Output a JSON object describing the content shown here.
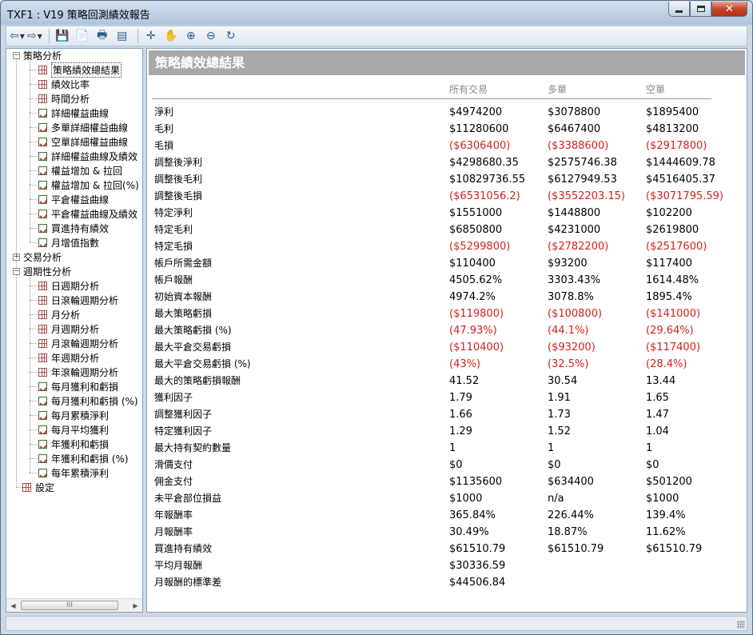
{
  "window": {
    "title": "TXF1 : V19 策略回測績效報告"
  },
  "tree": {
    "groups": [
      {
        "label": "策略分析",
        "expanded": true,
        "items": [
          {
            "label": "策略績效總結果",
            "icon": "grid",
            "selected": true
          },
          {
            "label": "績效比率",
            "icon": "grid"
          },
          {
            "label": "時間分析",
            "icon": "grid"
          },
          {
            "label": "詳細權益曲線",
            "icon": "chart"
          },
          {
            "label": "多單詳細權益曲線",
            "icon": "chart"
          },
          {
            "label": "空單詳細權益曲線",
            "icon": "chart"
          },
          {
            "label": "詳細權益曲線及績效",
            "icon": "chart"
          },
          {
            "label": "權益增加 & 拉回",
            "icon": "chart"
          },
          {
            "label": "權益增加 & 拉回(%)",
            "icon": "chart"
          },
          {
            "label": "平倉權益曲線",
            "icon": "chart"
          },
          {
            "label": "平倉權益曲線及績效",
            "icon": "chart"
          },
          {
            "label": "買進持有績效",
            "icon": "chart"
          },
          {
            "label": "月增值指數",
            "icon": "chart"
          }
        ]
      },
      {
        "label": "交易分析",
        "expanded": false,
        "items": []
      },
      {
        "label": "週期性分析",
        "expanded": true,
        "items": [
          {
            "label": "日週期分析",
            "icon": "grid"
          },
          {
            "label": "日滾輪週期分析",
            "icon": "grid"
          },
          {
            "label": "月分析",
            "icon": "grid"
          },
          {
            "label": "月週期分析",
            "icon": "grid"
          },
          {
            "label": "月滾輪週期分析",
            "icon": "grid"
          },
          {
            "label": "年週期分析",
            "icon": "grid"
          },
          {
            "label": "年滾輪週期分析",
            "icon": "grid"
          },
          {
            "label": "每月獲利和虧損",
            "icon": "chart"
          },
          {
            "label": "每月獲利和虧損 (%)",
            "icon": "chart"
          },
          {
            "label": "每月累積淨利",
            "icon": "chart"
          },
          {
            "label": "每月平均獲利",
            "icon": "chart"
          },
          {
            "label": "年獲利和虧損",
            "icon": "chart"
          },
          {
            "label": "年獲利和虧損 (%)",
            "icon": "chart"
          },
          {
            "label": "每年累積淨利",
            "icon": "chart"
          }
        ]
      },
      {
        "label": "設定",
        "icon": "grid",
        "leaf": true
      }
    ]
  },
  "report": {
    "title": "策略績效總結果",
    "columns": [
      "所有交易",
      "多單",
      "空單"
    ],
    "rows": [
      {
        "label": "淨利",
        "values": [
          "$4974200",
          "$3078800",
          "$1895400"
        ],
        "neg": false
      },
      {
        "label": "毛利",
        "values": [
          "$11280600",
          "$6467400",
          "$4813200"
        ],
        "neg": false
      },
      {
        "label": "毛損",
        "values": [
          "($6306400)",
          "($3388600)",
          "($2917800)"
        ],
        "neg": true
      },
      {
        "label": "調整後淨利",
        "values": [
          "$4298680.35",
          "$2575746.38",
          "$1444609.78"
        ],
        "neg": false
      },
      {
        "label": "調整後毛利",
        "values": [
          "$10829736.55",
          "$6127949.53",
          "$4516405.37"
        ],
        "neg": false
      },
      {
        "label": "調整後毛損",
        "values": [
          "($6531056.2)",
          "($3552203.15)",
          "($3071795.59)"
        ],
        "neg": true
      },
      {
        "label": "特定淨利",
        "values": [
          "$1551000",
          "$1448800",
          "$102200"
        ],
        "neg": false
      },
      {
        "label": "特定毛利",
        "values": [
          "$6850800",
          "$4231000",
          "$2619800"
        ],
        "neg": false
      },
      {
        "label": "特定毛損",
        "values": [
          "($5299800)",
          "($2782200)",
          "($2517600)"
        ],
        "neg": true
      },
      {
        "label": "帳戶所需金額",
        "values": [
          "$110400",
          "$93200",
          "$117400"
        ],
        "neg": false
      },
      {
        "label": "帳戶報酬",
        "values": [
          "4505.62%",
          "3303.43%",
          "1614.48%"
        ],
        "neg": false
      },
      {
        "label": "初始資本報酬",
        "values": [
          "4974.2%",
          "3078.8%",
          "1895.4%"
        ],
        "neg": false
      },
      {
        "label": "最大策略虧損",
        "values": [
          "($119800)",
          "($100800)",
          "($141000)"
        ],
        "neg": true
      },
      {
        "label": "最大策略虧損 (%)",
        "values": [
          "(47.93%)",
          "(44.1%)",
          "(29.64%)"
        ],
        "neg": true
      },
      {
        "label": "最大平倉交易虧損",
        "values": [
          "($110400)",
          "($93200)",
          "($117400)"
        ],
        "neg": true
      },
      {
        "label": "最大平倉交易虧損 (%)",
        "values": [
          "(43%)",
          "(32.5%)",
          "(28.4%)"
        ],
        "neg": true
      },
      {
        "label": "最大的策略虧損報酬",
        "values": [
          "41.52",
          "30.54",
          "13.44"
        ],
        "neg": false
      },
      {
        "label": "獲利因子",
        "values": [
          "1.79",
          "1.91",
          "1.65"
        ],
        "neg": false
      },
      {
        "label": "調整獲利因子",
        "values": [
          "1.66",
          "1.73",
          "1.47"
        ],
        "neg": false
      },
      {
        "label": "特定獲利因子",
        "values": [
          "1.29",
          "1.52",
          "1.04"
        ],
        "neg": false
      },
      {
        "label": "最大持有契約數量",
        "values": [
          "1",
          "1",
          "1"
        ],
        "neg": false
      },
      {
        "label": "滑價支付",
        "values": [
          "$0",
          "$0",
          "$0"
        ],
        "neg": false
      },
      {
        "label": "佣金支付",
        "values": [
          "$1135600",
          "$634400",
          "$501200"
        ],
        "neg": false
      },
      {
        "label": "未平倉部位損益",
        "values": [
          "$1000",
          "n/a",
          "$1000"
        ],
        "neg": false
      },
      {
        "label": "年報酬率",
        "values": [
          "365.84%",
          "226.44%",
          "139.4%"
        ],
        "neg": false
      },
      {
        "label": "月報酬率",
        "values": [
          "30.49%",
          "18.87%",
          "11.62%"
        ],
        "neg": false
      },
      {
        "label": "買進持有績效",
        "values": [
          "$61510.79",
          "$61510.79",
          "$61510.79"
        ],
        "neg": false
      },
      {
        "label": "平均月報酬",
        "values": [
          "$30336.59",
          "",
          ""
        ],
        "neg": false
      },
      {
        "label": "月報酬的標準差",
        "values": [
          "$44506.84",
          "",
          ""
        ],
        "neg": false
      }
    ]
  },
  "scroll": {
    "thumb_glyph": "III"
  }
}
